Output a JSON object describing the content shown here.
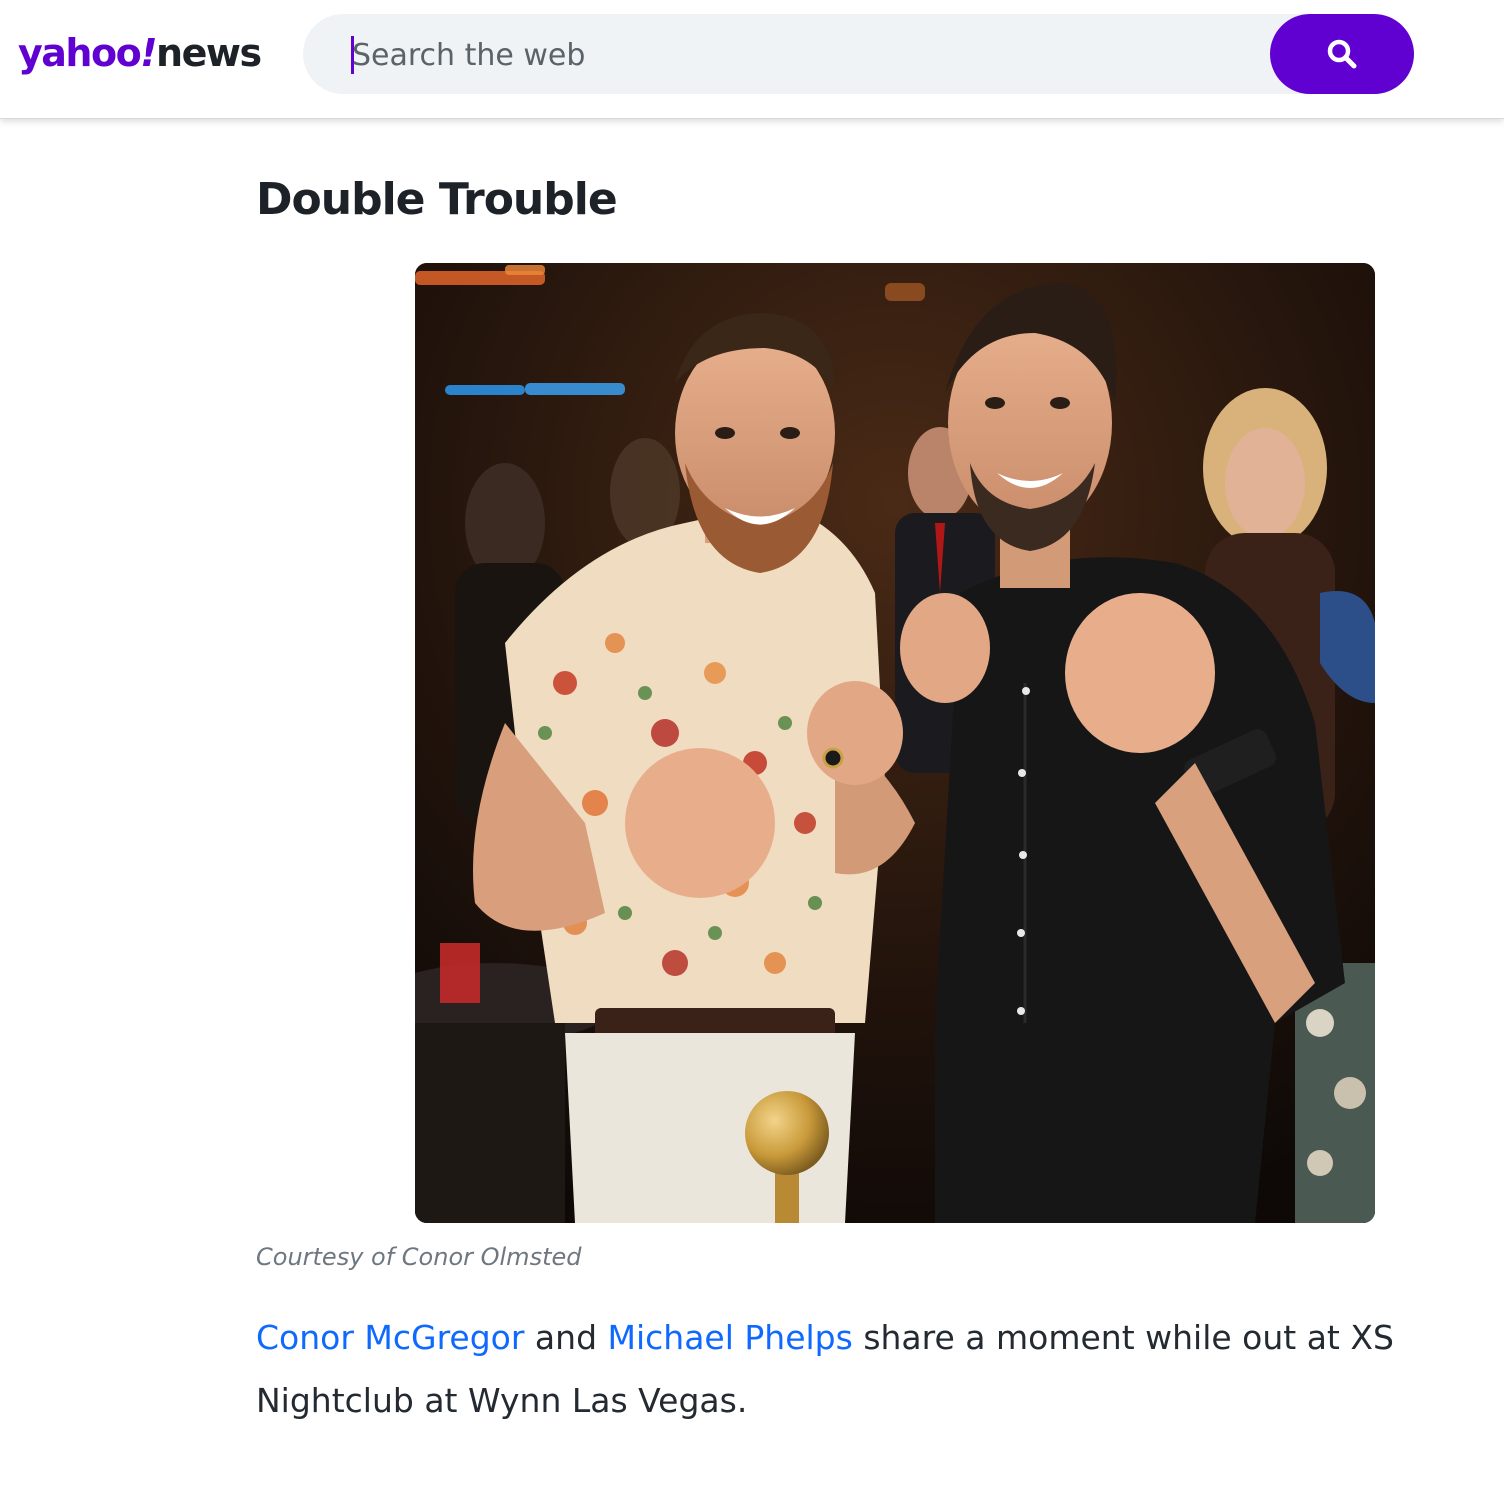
{
  "header": {
    "logo": {
      "brand": "yahoo",
      "bang": "!",
      "section": "news"
    },
    "search": {
      "placeholder": "Search the web",
      "value": ""
    },
    "search_button_icon": "search-icon"
  },
  "article": {
    "title": "Double Trouble",
    "image_credit": "Courtesy of Conor Olmsted",
    "caption": {
      "link1": "Conor McGregor",
      "text1": " and ",
      "link2": "Michael Phelps",
      "text2": " share a moment while out at XS Nightclub at Wynn Las Vegas."
    }
  },
  "colors": {
    "brand_purple": "#6001d2",
    "link_blue": "#0f69ff",
    "text_dark": "#1d2228",
    "credit_gray": "#6e7780",
    "search_bg": "#f0f3f5"
  }
}
